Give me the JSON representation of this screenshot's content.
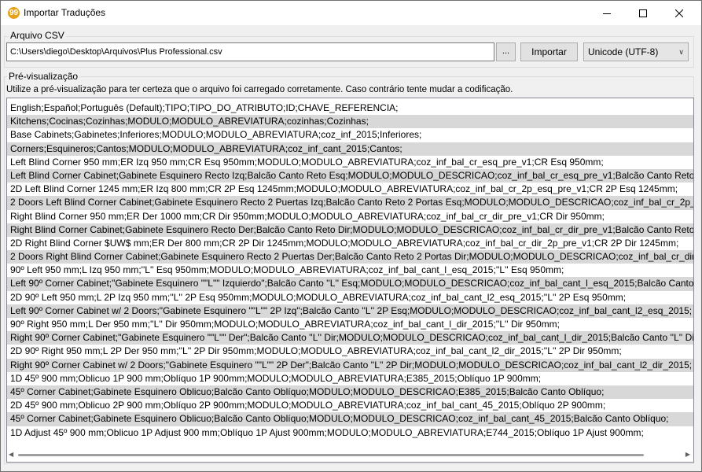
{
  "window": {
    "title": "Importar Traduções",
    "app_icon_glyph": "99"
  },
  "file_group": {
    "label": "Arquivo CSV",
    "path": "C:\\Users\\diego\\Desktop\\Arquivos\\Plus Professional.csv",
    "browse_label": "...",
    "import_label": "Importar",
    "encoding": "Unicode (UTF-8)"
  },
  "preview_group": {
    "label": "Pré-visualização",
    "hint": "Utilize a pré-visualização para ter certeza que o arquivo foi carregado corretamente. Caso contrário tente mudar a codificação.",
    "rows": [
      "English;Español;Português (Default);TIPO;TIPO_DO_ATRIBUTO;ID;CHAVE_REFERENCIA;",
      "Kitchens;Cocinas;Cozinhas;MODULO;MODULO_ABREVIATURA;cozinhas;Cozinhas;",
      "Base Cabinets;Gabinetes;Inferiores;MODULO;MODULO_ABREVIATURA;coz_inf_2015;Inferiores;",
      "Corners;Esquineros;Cantos;MODULO;MODULO_ABREVIATURA;coz_inf_cant_2015;Cantos;",
      "Left Blind Corner 950 mm;ER Izq 950 mm;CR Esq 950mm;MODULO;MODULO_ABREVIATURA;coz_inf_bal_cr_esq_pre_v1;CR Esq 950mm;",
      "Left Blind Corner Cabinet;Gabinete Esquinero Recto Izq;Balcão Canto Reto Esq;MODULO;MODULO_DESCRICAO;coz_inf_bal_cr_esq_pre_v1;Balcão Canto Reto Esq;",
      "2D Left Blind Corner 1245 mm;ER Izq 800 mm;CR 2P Esq 1245mm;MODULO;MODULO_ABREVIATURA;coz_inf_bal_cr_2p_esq_pre_v1;CR 2P Esq 1245mm;",
      "2 Doors Left Blind Corner Cabinet;Gabinete Esquinero Recto 2 Puertas Izq;Balcão Canto Reto 2 Portas Esq;MODULO;MODULO_DESCRICAO;coz_inf_bal_cr_2p_esq_pre_v1;",
      "Right Blind Corner 950 mm;ER Der 1000 mm;CR Dir 950mm;MODULO;MODULO_ABREVIATURA;coz_inf_bal_cr_dir_pre_v1;CR Dir 950mm;",
      "Right Blind Corner Cabinet;Gabinete Esquinero Recto Der;Balcão Canto Reto Dir;MODULO;MODULO_DESCRICAO;coz_inf_bal_cr_dir_pre_v1;Balcão Canto Reto Dir;",
      "2D Right Blind Corner $UW$ mm;ER Der 800 mm;CR 2P Dir 1245mm;MODULO;MODULO_ABREVIATURA;coz_inf_bal_cr_dir_2p_pre_v1;CR 2P Dir 1245mm;",
      "2 Doors Right Blind Corner Cabinet;Gabinete Esquinero Recto 2 Puertas Der;Balcão Canto Reto 2 Portas Dir;MODULO;MODULO_DESCRICAO;coz_inf_bal_cr_dir_2p_pre_v1;",
      "90º Left 950 mm;L Izq 950 mm;''L'' Esq 950mm;MODULO;MODULO_ABREVIATURA;coz_inf_bal_cant_l_esq_2015;''L'' Esq 950mm;",
      "Left 90º Corner Cabinet;\"Gabinete Esquinero \"\"L\"\" Izquierdo\";Balcão Canto ''L'' Esq;MODULO;MODULO_DESCRICAO;coz_inf_bal_cant_l_esq_2015;Balcão Canto ''L'' Esq;",
      "2D 90º Left 950 mm;L 2P Izq 950 mm;''L'' 2P Esq 950mm;MODULO;MODULO_ABREVIATURA;coz_inf_bal_cant_l2_esq_2015;''L'' 2P Esq 950mm;",
      "Left 90º Corner Cabinet w/ 2 Doors;\"Gabinete Esquinero \"\"L\"\" 2P Izq\";Balcão Canto ''L'' 2P Esq;MODULO;MODULO_DESCRICAO;coz_inf_bal_cant_l2_esq_2015;",
      "90º Right 950 mm;L Der 950 mm;''L'' Dir 950mm;MODULO;MODULO_ABREVIATURA;coz_inf_bal_cant_l_dir_2015;''L'' Dir 950mm;",
      "Right 90º Corner Cabinet;\"Gabinete Esquinero \"\"L\"\" Der\";Balcão Canto ''L'' Dir;MODULO;MODULO_DESCRICAO;coz_inf_bal_cant_l_dir_2015;Balcão Canto ''L'' Dir;",
      "2D 90º Right 950 mm;L 2P Der 950 mm;''L'' 2P Dir 950mm;MODULO;MODULO_ABREVIATURA;coz_inf_bal_cant_l2_dir_2015;''L'' 2P Dir 950mm;",
      "Right 90º Corner Cabinet w/ 2 Doors;\"Gabinete Esquinero \"\"L\"\" 2P Der\";Balcão Canto ''L'' 2P Dir;MODULO;MODULO_DESCRICAO;coz_inf_bal_cant_l2_dir_2015;",
      "1D 45º 900 mm;Oblicuo 1P 900 mm;Oblíquo 1P 900mm;MODULO;MODULO_ABREVIATURA;E385_2015;Oblíquo 1P 900mm;",
      "45º Corner Cabinet;Gabinete Esquinero Oblicuo;Balcão Canto Oblíquo;MODULO;MODULO_DESCRICAO;E385_2015;Balcão Canto Oblíquo;",
      "2D 45º 900 mm;Oblicuo 2P 900 mm;Oblíquo 2P 900mm;MODULO;MODULO_ABREVIATURA;coz_inf_bal_cant_45_2015;Oblíquo 2P 900mm;",
      "45º Corner Cabinet;Gabinete Esquinero Oblicuo;Balcão Canto Oblíquo;MODULO;MODULO_DESCRICAO;coz_inf_bal_cant_45_2015;Balcão Canto Oblíquo;",
      "1D Adjust 45º 900 mm;Oblicuo 1P Adjust 900 mm;Oblíquo 1P Ajust 900mm;MODULO;MODULO_ABREVIATURA;E744_2015;Oblíquo 1P Ajust 900mm;"
    ]
  },
  "colors": {
    "alt_row": "#d8d8d8",
    "window_bg": "#f0f0f0",
    "app_icon": "#e8a21a"
  }
}
